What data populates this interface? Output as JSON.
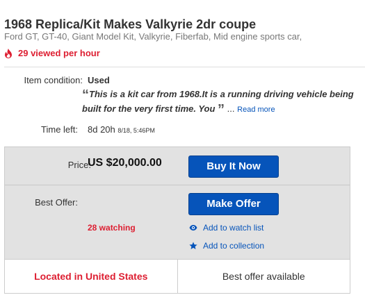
{
  "listing": {
    "title": "1968 Replica/Kit Makes Valkyrie 2dr coupe",
    "subtitle": "Ford GT, GT-40, Giant Model Kit, Valkyrie, Fiberfab, Mid engine sports car,",
    "views": "29 viewed per hour"
  },
  "condition": {
    "label": "Item condition:",
    "value": "Used",
    "quote_open": "“",
    "quote_text": "This is a kit car from 1968.It is a running driving vehicle being built for the very first time. You",
    "quote_close": "”",
    "ellipsis": "...",
    "read_more": "Read more"
  },
  "time": {
    "label": "Time left:",
    "value": "8d 20h",
    "end": "8/18, 5:46PM"
  },
  "price": {
    "label": "Price:",
    "value": "US $20,000.00",
    "buy_button": "Buy It Now"
  },
  "offer": {
    "label": "Best Offer:",
    "button": "Make Offer",
    "watching": "28 watching",
    "watch_link": "Add to watch list",
    "collection_link": "Add to collection"
  },
  "footer": {
    "location": "Located in United States",
    "best_offer": "Best offer available"
  },
  "colors": {
    "accent_red": "#dd1e31",
    "button_blue": "#0654ba",
    "panel_gray": "#e2e2e2"
  },
  "icons": {
    "views": "flame-icon",
    "watch": "eye-icon",
    "collection": "star-icon"
  }
}
